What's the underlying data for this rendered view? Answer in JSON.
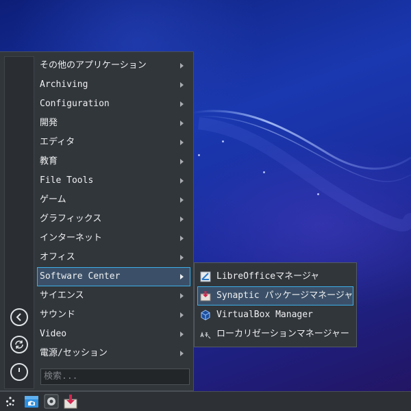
{
  "menu": {
    "items": [
      {
        "label": "その他のアプリケーション"
      },
      {
        "label": "Archiving"
      },
      {
        "label": "Configuration"
      },
      {
        "label": "開発"
      },
      {
        "label": "エディタ"
      },
      {
        "label": "教育"
      },
      {
        "label": "File Tools"
      },
      {
        "label": "ゲーム"
      },
      {
        "label": "グラフィックス"
      },
      {
        "label": "インターネット"
      },
      {
        "label": "オフィス"
      },
      {
        "label": "Software Center",
        "selected": true
      },
      {
        "label": "サイエンス"
      },
      {
        "label": "サウンド"
      },
      {
        "label": "Video"
      },
      {
        "label": "電源/セッション"
      }
    ],
    "search_placeholder": "検索..."
  },
  "submenu": {
    "items": [
      {
        "label": "LibreOfficeマネージャ",
        "icon": "libreoffice-manager-icon"
      },
      {
        "label": "Synaptic パッケージマネージャ",
        "icon": "synaptic-icon",
        "selected": true
      },
      {
        "label": "VirtualBox Manager",
        "icon": "virtualbox-icon"
      },
      {
        "label": "ローカリゼーションマネージャー",
        "icon": "localization-icon"
      }
    ]
  },
  "rail": {
    "icons": [
      "back-icon",
      "switch-user-icon",
      "power-icon"
    ]
  },
  "taskbar": {
    "icons": [
      "app-menu-icon",
      "file-manager-icon",
      "settings-icon",
      "package-installer-icon"
    ]
  },
  "colors": {
    "accent": "#3daee9",
    "menu_bg": "#31363b",
    "selection_bg": "#3b5068",
    "text": "#eff0f1"
  }
}
